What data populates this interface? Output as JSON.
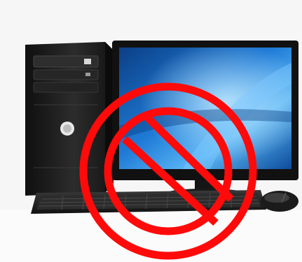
{
  "image": {
    "subject": "desktop-computer-with-prohibition-sign",
    "colors": {
      "background": "#f6f6f6",
      "tower": "#1b1b1b",
      "screen": "#1f7bd6",
      "prohibition": "#ff0a0a",
      "keyboard": "#242424"
    },
    "objects": [
      "tower-case",
      "monitor",
      "keyboard",
      "mouse",
      "prohibition-sign"
    ]
  }
}
